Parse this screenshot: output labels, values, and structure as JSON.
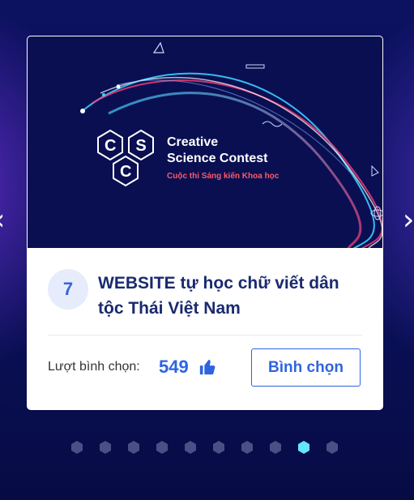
{
  "carousel": {
    "prev_icon": "chevron-left-icon",
    "next_icon": "chevron-right-icon"
  },
  "banner": {
    "logo_letters": [
      "C",
      "S",
      "C"
    ],
    "brand_line1": "Creative",
    "brand_line2": "Science Contest",
    "brand_subtitle": "Cuộc thi Sáng kiến Khoa học"
  },
  "entry": {
    "rank": "7",
    "title": "WEBSITE tự học chữ viết dân tộc Thái Việt Nam",
    "vote_label": "Lượt bình chọn:",
    "vote_count": "549",
    "vote_icon": "thumbs-up-icon",
    "vote_button": "Bình chọn"
  },
  "pagination": {
    "total": 10,
    "active_index": 8
  },
  "colors": {
    "background": "#0a1058",
    "accent": "#2f64e0",
    "active_dot": "#64e6ff",
    "brand_red": "#ff5a66"
  }
}
